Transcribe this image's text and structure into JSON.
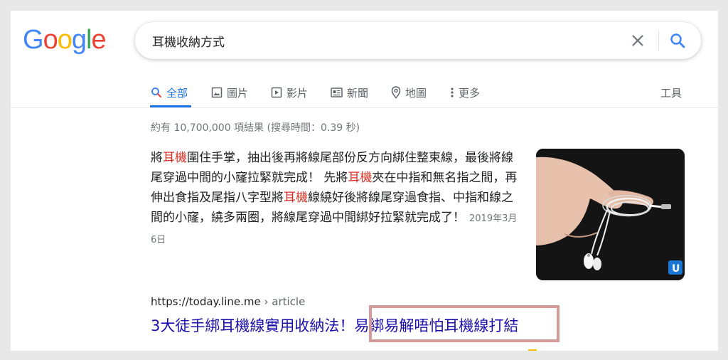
{
  "logo": {
    "letters": [
      "G",
      "o",
      "o",
      "g",
      "l",
      "e"
    ],
    "colors": [
      "#4285F4",
      "#EA4335",
      "#FBBC05",
      "#4285F4",
      "#34A853",
      "#EA4335"
    ]
  },
  "search": {
    "query": "耳機收納方式",
    "clear_icon": "close-icon",
    "search_icon": "search-icon"
  },
  "tabs": [
    {
      "label": "全部",
      "icon": "search-icon",
      "active": true
    },
    {
      "label": "圖片",
      "icon": "image-icon"
    },
    {
      "label": "影片",
      "icon": "video-icon"
    },
    {
      "label": "新聞",
      "icon": "news-icon"
    },
    {
      "label": "地圖",
      "icon": "map-pin-icon"
    },
    {
      "label": "更多",
      "icon": "more-vert-icon"
    }
  ],
  "tools_label": "工具",
  "stats": "約有 10,700,000 項結果 (搜尋時間：0.39 秒)",
  "snippet": {
    "parts": [
      "將",
      "耳機",
      "圍住手掌，抽出後再將線尾部份反方向綁住整束線，最後將線尾穿過中間的小窿拉緊就完成！ 先將",
      "耳機",
      "夾在中指和無名指之間，再伸出食指及尾指八字型將",
      "耳機",
      "線繞好後將線尾穿過食指、中指和線之間的小窿，繞多兩圈，將線尾穿過中間綁好拉緊就完成了！"
    ],
    "date": "2019年3月6日"
  },
  "result": {
    "url": "https://today.line.me",
    "breadcrumb": " › article",
    "title": "3大徒手綁耳機線實用收納法！易綁易解唔怕耳機線打結"
  },
  "colors": {
    "accent": "#1a73e8",
    "link": "#1a0dab",
    "highlight_text": "#d93025",
    "annotation_box": "#d49a9a"
  }
}
